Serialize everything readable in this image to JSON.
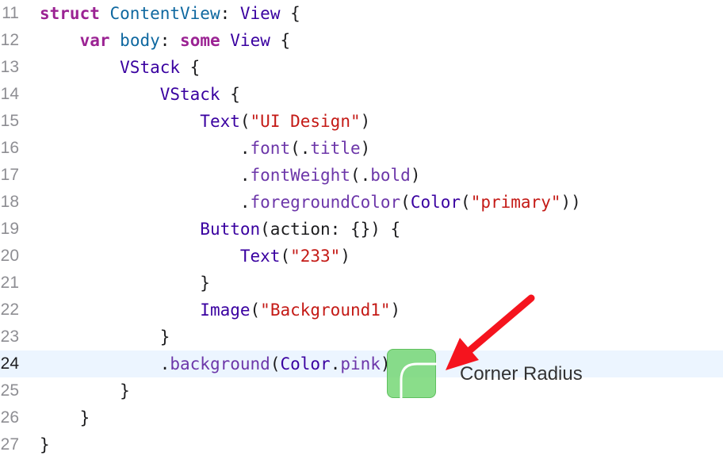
{
  "editor": {
    "current_line": "24",
    "lines": [
      {
        "num": "11",
        "tokens": [
          "struct",
          " ",
          "ContentView",
          ": ",
          "View",
          " {"
        ]
      },
      {
        "num": "12",
        "tokens": [
          "    ",
          "var",
          " ",
          "body",
          ": ",
          "some",
          " ",
          "View",
          " {"
        ]
      },
      {
        "num": "13",
        "tokens": [
          "        ",
          "VStack",
          " {"
        ]
      },
      {
        "num": "14",
        "tokens": [
          "            ",
          "VStack",
          " {"
        ]
      },
      {
        "num": "15",
        "tokens": [
          "                ",
          "Text",
          "(",
          "\"UI Design\"",
          ")"
        ]
      },
      {
        "num": "16",
        "tokens": [
          "                    .",
          "font",
          "(.",
          "title",
          ")"
        ]
      },
      {
        "num": "17",
        "tokens": [
          "                    .",
          "fontWeight",
          "(.",
          "bold",
          ")"
        ]
      },
      {
        "num": "18",
        "tokens": [
          "                    .",
          "foregroundColor",
          "(",
          "Color",
          "(",
          "\"primary\"",
          "))"
        ]
      },
      {
        "num": "19",
        "tokens": [
          "                ",
          "Button",
          "(action: {}) {"
        ]
      },
      {
        "num": "20",
        "tokens": [
          "                    ",
          "Text",
          "(",
          "\"233\"",
          ")"
        ]
      },
      {
        "num": "21",
        "tokens": [
          "                }"
        ]
      },
      {
        "num": "22",
        "tokens": [
          "                ",
          "Image",
          "(",
          "\"Background1\"",
          ")"
        ]
      },
      {
        "num": "23",
        "tokens": [
          "            }"
        ]
      },
      {
        "num": "24",
        "tokens": [
          "            .",
          "background",
          "(",
          "Color",
          ".",
          "pink",
          ")"
        ]
      },
      {
        "num": "25",
        "tokens": [
          "        }"
        ]
      },
      {
        "num": "26",
        "tokens": [
          "    }"
        ]
      },
      {
        "num": "27",
        "tokens": [
          "}"
        ]
      }
    ]
  },
  "annotation": {
    "label": "Corner Radius",
    "arrow_color": "#f5141e"
  },
  "swatch": {
    "color": "#70d670",
    "icon": "color-swatch-icon"
  },
  "colors": {
    "keyword": "#9b2393",
    "type": "#3900a0",
    "declaration": "#0f68a0",
    "string": "#c41a16",
    "member": "#6c36a9",
    "plain": "#1c1c1e",
    "current_line_bg": "#ecf5ff"
  }
}
